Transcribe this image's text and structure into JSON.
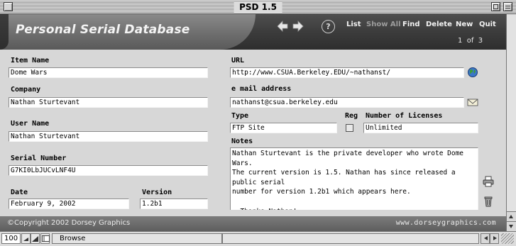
{
  "window": {
    "title": "PSD 1.5"
  },
  "header": {
    "app_title": "Personal Serial Database",
    "help_label": "?",
    "menu": {
      "list": "List",
      "show_all": "Show All",
      "find": "Find",
      "delete": "Delete",
      "new": "New",
      "quit": "Quit"
    },
    "record_counter": "1  of  3"
  },
  "form": {
    "item_name": {
      "label": "Item Name",
      "value": "Dome Wars"
    },
    "company": {
      "label": "Company",
      "value": "Nathan Sturtevant"
    },
    "user_name": {
      "label": "User Name",
      "value": "Nathan Sturtevant"
    },
    "serial_number": {
      "label": "Serial Number",
      "value": "G7KI0LbJUCvLNF4U"
    },
    "date": {
      "label": "Date",
      "value": "February 9, 2002"
    },
    "version": {
      "label": "Version",
      "value": "1.2b1"
    },
    "url": {
      "label": "URL",
      "value": "http://www.CSUA.Berkeley.EDU/~nathanst/"
    },
    "email": {
      "label": "e mail address",
      "value": "nathanst@csua.berkeley.edu"
    },
    "type": {
      "label": "Type",
      "value": "FTP Site"
    },
    "reg": {
      "label": "Reg",
      "checked": false
    },
    "licenses": {
      "label": "Number of Licenses",
      "value": "Unlimited"
    },
    "notes": {
      "label": "Notes",
      "value": "Nathan Sturtevant is the private developer who wrote Dome Wars.\nThe current version is 1.5. Nathan has since released a public serial\nnumber for version 1.2b1 which appears here.\n\n  Thanks Nathan!"
    }
  },
  "footer": {
    "copyright": "©Copyright 2002 Dorsey Graphics",
    "website": "www.dorseygraphics.com"
  },
  "statusbar": {
    "zoom": "100",
    "mode": "Browse"
  },
  "icons": {
    "globe": "globe-icon",
    "mail": "envelope-icon",
    "print": "printer-icon",
    "trash": "trash-icon"
  }
}
